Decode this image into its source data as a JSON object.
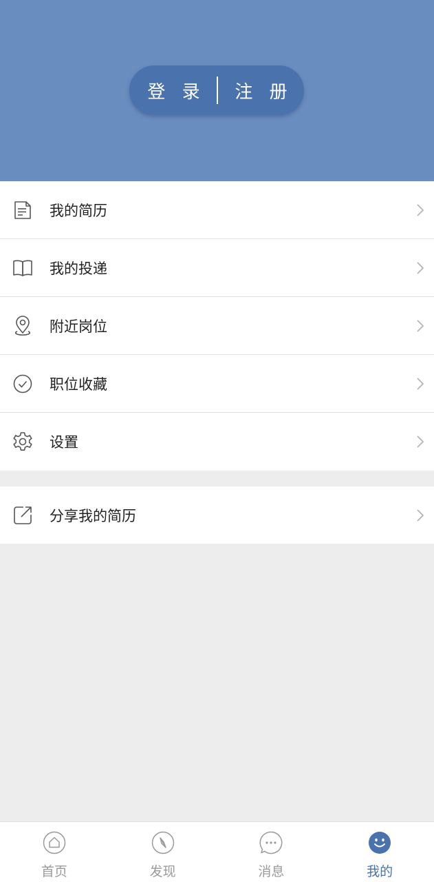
{
  "header": {
    "login_label": "登 录",
    "register_label": "注 册"
  },
  "menu": {
    "items": [
      {
        "label": "我的简历",
        "icon": "resume-doc-icon"
      },
      {
        "label": "我的投递",
        "icon": "open-book-icon"
      },
      {
        "label": "附近岗位",
        "icon": "location-pin-icon"
      },
      {
        "label": "职位收藏",
        "icon": "check-circle-icon"
      },
      {
        "label": "设置",
        "icon": "gear-icon"
      }
    ]
  },
  "share": {
    "label": "分享我的简历",
    "icon": "share-external-icon"
  },
  "tabbar": {
    "tabs": [
      {
        "label": "首页",
        "icon": "home-icon",
        "active": false
      },
      {
        "label": "发现",
        "icon": "compass-icon",
        "active": false
      },
      {
        "label": "消息",
        "icon": "chat-bubble-icon",
        "active": false
      },
      {
        "label": "我的",
        "icon": "smiley-icon",
        "active": true
      }
    ]
  },
  "colors": {
    "header_bg": "#6a8dc0",
    "pill_bg": "#4a72ad",
    "accent": "#4a72ad",
    "page_bg": "#ededed",
    "tab_inactive": "#9a9a9a"
  }
}
